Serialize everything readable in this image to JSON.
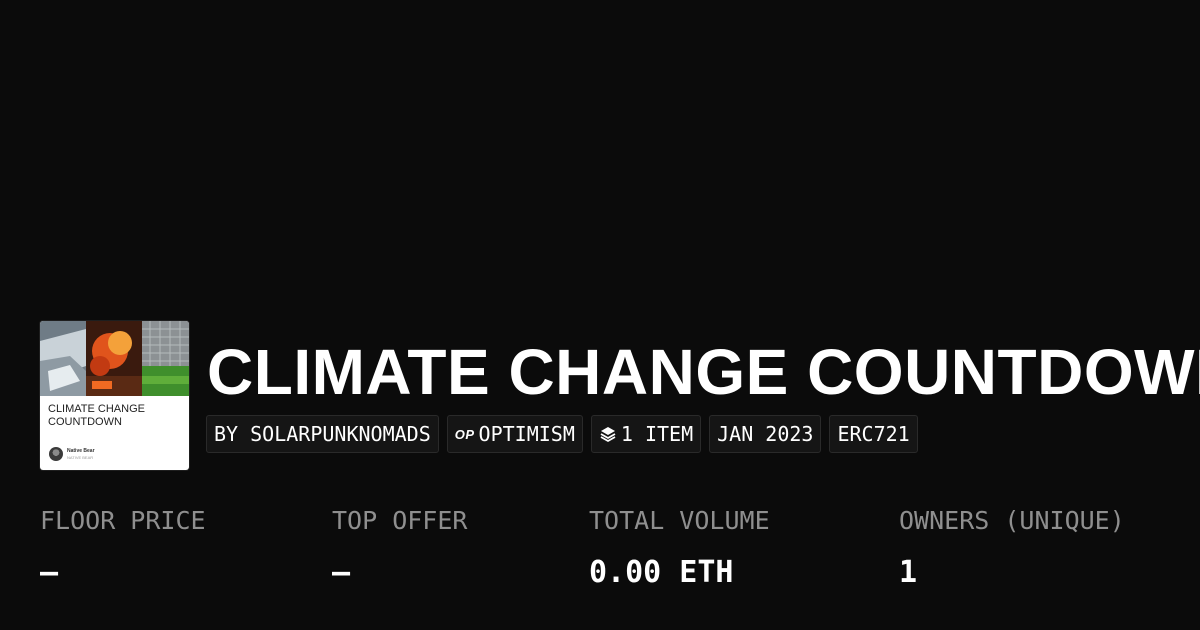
{
  "collection": {
    "title": "CLIMATE CHANGE COUNTDOWN",
    "thumbnail": {
      "title": "CLIMATE CHANGE COUNTDOWN",
      "author": "Native Bear",
      "author_sub": "NATIVE BEAR"
    }
  },
  "chips": {
    "creator": "BY SOLARPUNKNOMADS",
    "chain_icon": "OP",
    "chain": "OPTIMISM",
    "items_icon": "layers-icon",
    "items": "1 ITEM",
    "date": "JAN 2023",
    "standard": "ERC721"
  },
  "stats": {
    "floor_price": {
      "label": "FLOOR PRICE",
      "value": "–"
    },
    "top_offer": {
      "label": "TOP OFFER",
      "value": "–"
    },
    "total_volume": {
      "label": "TOTAL VOLUME",
      "value": "0.00 ETH"
    },
    "owners": {
      "label": "OWNERS (UNIQUE)",
      "value": "1"
    }
  },
  "colors": {
    "background": "#0b0b0b",
    "text": "#ffffff",
    "muted": "#8f8f8f",
    "chip_border": "#2a2a2a"
  }
}
